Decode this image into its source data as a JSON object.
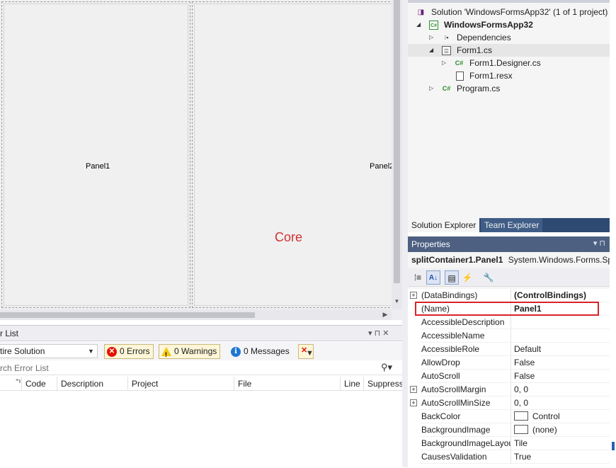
{
  "designer": {
    "panel1_label": "Panel1",
    "panel2_label": "Panel2",
    "watermark": "Core"
  },
  "error_list": {
    "title": "r List",
    "title_buttons": "▾ ⊓ ✕",
    "scope": "tire Solution",
    "errors_label": "0 Errors",
    "warnings_label": "0 Warnings",
    "messages_label": "0 Messages",
    "search_placeholder": "rch Error List",
    "columns": [
      "Code",
      "Description",
      "Project",
      "File",
      "Line",
      "Suppress"
    ]
  },
  "solution_explorer": {
    "items": [
      {
        "label": "Solution 'WindowsFormsApp32' (1 of 1 project)"
      },
      {
        "label": "WindowsFormsApp32"
      },
      {
        "label": "Dependencies"
      },
      {
        "label": "Form1.cs"
      },
      {
        "label": "Form1.Designer.cs"
      },
      {
        "label": "Form1.resx"
      },
      {
        "label": "Program.cs"
      }
    ],
    "tabs": [
      "Solution Explorer",
      "Team Explorer"
    ]
  },
  "properties": {
    "title": "Properties",
    "title_buttons": "▾ ⊓",
    "object_name": "splitContainer1.Panel1",
    "object_type": "System.Windows.Forms.SplitterPanel",
    "rows": [
      {
        "name": "(DataBindings)",
        "value": "(ControlBindings)"
      },
      {
        "name": "(Name)",
        "value": "Panel1"
      },
      {
        "name": "AccessibleDescription",
        "value": ""
      },
      {
        "name": "AccessibleName",
        "value": ""
      },
      {
        "name": "AccessibleRole",
        "value": "Default"
      },
      {
        "name": "AllowDrop",
        "value": "False"
      },
      {
        "name": "AutoScroll",
        "value": "False"
      },
      {
        "name": "AutoScrollMargin",
        "value": "0, 0"
      },
      {
        "name": "AutoScrollMinSize",
        "value": "0, 0"
      },
      {
        "name": "BackColor",
        "value": "Control"
      },
      {
        "name": "BackgroundImage",
        "value": "(none)"
      },
      {
        "name": "BackgroundImageLayout",
        "value": "Tile"
      },
      {
        "name": "CausesValidation",
        "value": "True"
      }
    ]
  },
  "colors": {
    "tab_strip": "#2e4a73",
    "properties_title": "#4d6082",
    "highlight": "#d8232a",
    "watermark": "#d23030"
  }
}
